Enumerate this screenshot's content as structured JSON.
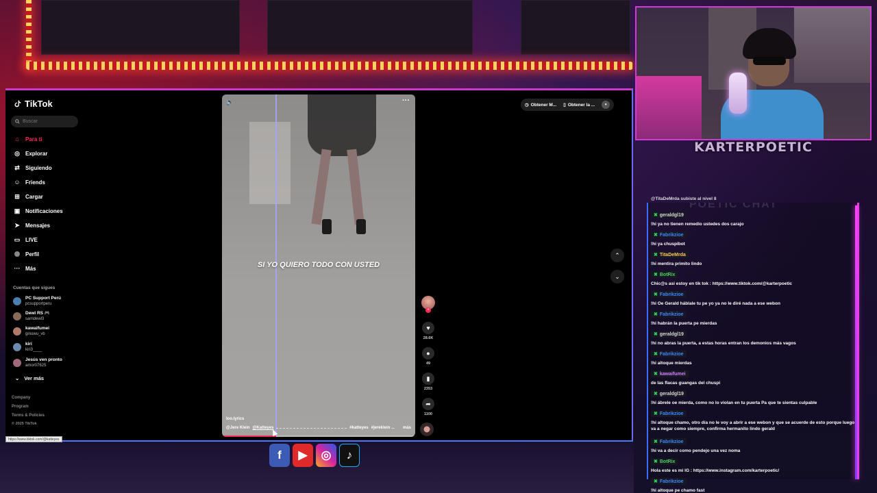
{
  "tiktok": {
    "logo": "TikTok",
    "search_placeholder": "Buscar",
    "nav": [
      {
        "label": "Para ti",
        "icon": "home-icon",
        "active": true
      },
      {
        "label": "Explorar",
        "icon": "compass-icon"
      },
      {
        "label": "Siguiendo",
        "icon": "following-icon"
      },
      {
        "label": "Friends",
        "icon": "friends-icon"
      },
      {
        "label": "Cargar",
        "icon": "upload-icon"
      },
      {
        "label": "Notificaciones",
        "icon": "bell-icon"
      },
      {
        "label": "Mensajes",
        "icon": "send-icon"
      },
      {
        "label": "LIVE",
        "icon": "live-icon"
      },
      {
        "label": "Perfil",
        "icon": "profile-icon"
      },
      {
        "label": "Más",
        "icon": "more-icon"
      }
    ],
    "following_title": "Cuentas que sigues",
    "following": [
      {
        "name": "PC Support Perú",
        "user": "pcsupportperu",
        "color": "#4a7fb0"
      },
      {
        "name": "Dewl RS 🎮",
        "user": "sarridewl3",
        "color": "#8a6a5a"
      },
      {
        "name": "kawaifumei",
        "user": "ginuwu_vb",
        "color": "#b07a6a"
      },
      {
        "name": "kiri",
        "user": "kiri3____",
        "color": "#6a8ab0"
      },
      {
        "name": "Jesús ven pronto",
        "user": "amor07625",
        "color": "#a06a7a"
      }
    ],
    "see_more": "Ver más",
    "footer": [
      "Company",
      "Program",
      "Terms & Policies",
      "© 2025 TikTok"
    ],
    "url_tooltip": "https://www.tiktok.com/@katteyes",
    "video": {
      "lyric": "SI YO QUIERO TODO CON USTED",
      "author": "loo.lyrics",
      "tags": [
        "@Jere Klein",
        "@Katteyes"
      ],
      "hashtags": [
        "#katteyes",
        "#jereklein ..."
      ],
      "more_label": "más",
      "progress": 0.28
    },
    "actions": {
      "likes": "28.6K",
      "comments": "49",
      "saves": "2353",
      "shares": "1100"
    },
    "top_buttons": [
      "Obtener M...",
      "Obtener la ..."
    ]
  },
  "stream": {
    "streamer_name": "KARTERPOETIC",
    "chat_bg_title": "POETIC CHAT",
    "chat_top_line": "@TitaDeMrda subiste al nivel 8",
    "chat": [
      {
        "user": "geraldgl19",
        "color": "#d8d8d8",
        "text": "!hi ya no tienen remedio ustedes dos carajo"
      },
      {
        "user": "Fabrikzioe",
        "color": "#3a8aff",
        "text": "!hi ya chuspibot"
      },
      {
        "user": "TitaDeMrda",
        "color": "#ffc860",
        "text": "!hi mentira primito lindo"
      },
      {
        "user": "BotRix",
        "color": "#4ad060",
        "text": "Chic@s asi estoy en tik tok : https://www.tiktok.com/@karterpoetic"
      },
      {
        "user": "Fabrikzioe",
        "color": "#3a8aff",
        "text": "!hi Oe Gerald háblale tu pe yo ya no le diré nada a ese webon"
      },
      {
        "user": "Fabrikzioe",
        "color": "#3a8aff",
        "text": "!hi habrán la puerta pe mierdas"
      },
      {
        "user": "geraldgl19",
        "color": "#d8d8d8",
        "text": "!hi no abras la puerta, a estas horas entran los demonios más vagos"
      },
      {
        "user": "Fabrikzioe",
        "color": "#3a8aff",
        "text": "!hi altoque mierdas"
      },
      {
        "user": "kawaifumei",
        "color": "#d080ff",
        "text": "de las flacas guangas del chuspi"
      },
      {
        "user": "geraldgl19",
        "color": "#d8d8d8",
        "text": "!hi ábrele oe mierda, como no lo violan en tu puerta Pa que te sientas culpable"
      },
      {
        "user": "Fabrikzioe",
        "color": "#3a8aff",
        "text": "!hi altoque chamo, otro día no le voy a abrir a ese webon y que se acuerde de esto porque luego va a negar como siempre, confirma hermanito lindo gerald"
      },
      {
        "user": "Fabrikzioe",
        "color": "#3a8aff",
        "text": "!hi va a decir como pendejo una vez noma"
      },
      {
        "user": "BotRix",
        "color": "#4ad060",
        "text": "Hola este es mi IG : https://www.instagram.com/karterpoetic/"
      },
      {
        "user": "Fabrikzioe",
        "color": "#3a8aff",
        "text": "!hi altoque pe chamo fast"
      }
    ]
  }
}
